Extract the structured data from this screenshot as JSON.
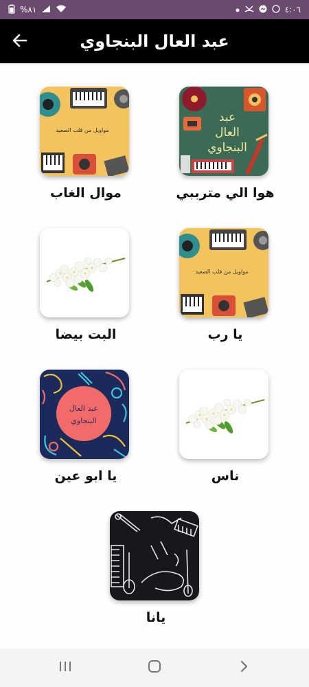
{
  "status_bar": {
    "time": "٤:٠٦",
    "battery": "%٨١",
    "icons_right": [
      "battery-icon",
      "signal-icon",
      "wifi-icon"
    ],
    "icons_left": [
      "messenger-icon",
      "whatsapp-icon",
      "missed-call-icon",
      "dot-icon"
    ]
  },
  "app_bar": {
    "title": "عبد العال البنجاوي",
    "back_icon": "arrow-left-icon"
  },
  "songs": [
    {
      "title": "هوا الي مترببي",
      "artwork": "music-collage-title"
    },
    {
      "title": "موال الغاب",
      "artwork": "instruments-yellow"
    },
    {
      "title": "يا رب",
      "artwork": "instruments-yellow"
    },
    {
      "title": "البت بيضا",
      "artwork": "jasmine-flowers"
    },
    {
      "title": "ناس",
      "artwork": "jasmine-flowers"
    },
    {
      "title": "يا ابو عين",
      "artwork": "neon-instruments-title"
    },
    {
      "title": "يانا",
      "artwork": "dark-instruments"
    }
  ],
  "artwork_texts": {
    "collage_title": [
      "عبد",
      "العال",
      "البنجاوي"
    ],
    "yellow_caption": "مواويل من قلب الصعيد",
    "neon_title": [
      "عبد العال",
      "البنجاوي"
    ]
  },
  "nav_bar": {
    "icons": [
      "recent-apps-icon",
      "home-icon",
      "back-chevron-icon"
    ]
  },
  "colors": {
    "status_bar": "#6a4a6e",
    "app_bar": "#000000",
    "yellow_art": "#f3c35e",
    "collage_art": "#3c6b55",
    "neon_art": "#1b2a5a",
    "dark_art": "#17181c"
  }
}
